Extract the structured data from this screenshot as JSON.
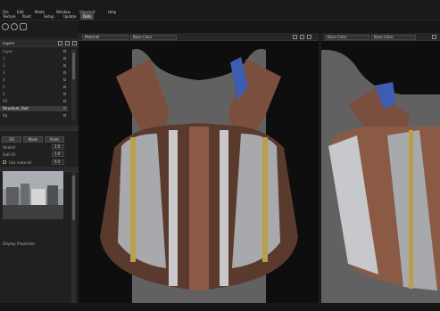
{
  "menubar": {
    "items": [
      {
        "label": "File",
        "active": false
      },
      {
        "label": "Edit",
        "active": false
      },
      {
        "label": "Mode",
        "active": false
      },
      {
        "label": "Window",
        "active": false
      },
      {
        "label": "Viewport",
        "active": false
      },
      {
        "label": "Help",
        "active": false
      }
    ],
    "tabs": [
      {
        "label": "Texture",
        "active": false
      },
      {
        "label": "Paint",
        "active": false
      },
      {
        "label": "Setup",
        "active": false
      },
      {
        "label": "Update",
        "active": false
      },
      {
        "label": "Dots",
        "active": true
      }
    ]
  },
  "layers": {
    "header": "Layers",
    "rows": [
      {
        "label": "Layer",
        "selected": false
      },
      {
        "label": "1",
        "selected": false
      },
      {
        "label": "2",
        "selected": false
      },
      {
        "label": "3",
        "selected": false
      },
      {
        "label": "4",
        "selected": false
      },
      {
        "label": "5",
        "selected": false
      },
      {
        "label": "6",
        "selected": false
      },
      {
        "label": "Fill",
        "selected": false
      },
      {
        "label": "Structure_Fast",
        "selected": true
      },
      {
        "label": "Bg",
        "selected": false
      }
    ]
  },
  "properties": {
    "buttons": [
      "Fill",
      "Mask",
      "Paint"
    ],
    "fields": [
      {
        "label": "Stretch",
        "value": "1.0"
      },
      {
        "label": "Soft Fill",
        "value": "1.0"
      },
      {
        "label": "Tol",
        "value": "0.0"
      }
    ],
    "checkbox_label": "Use material",
    "environment_label": "Environment",
    "bottom_label": "Display Properties"
  },
  "viewport_left": {
    "dropdown1": "Material",
    "dropdown2": "Base Color"
  },
  "viewport_right": {
    "dropdown1": "Base Color",
    "dropdown2": "Base Color"
  },
  "colors": {
    "accent": "#3f5db0",
    "leather": "#8a5a45",
    "metal": "#a7a9ad",
    "gold": "#b9a14a",
    "bg_gray": "#606060"
  }
}
